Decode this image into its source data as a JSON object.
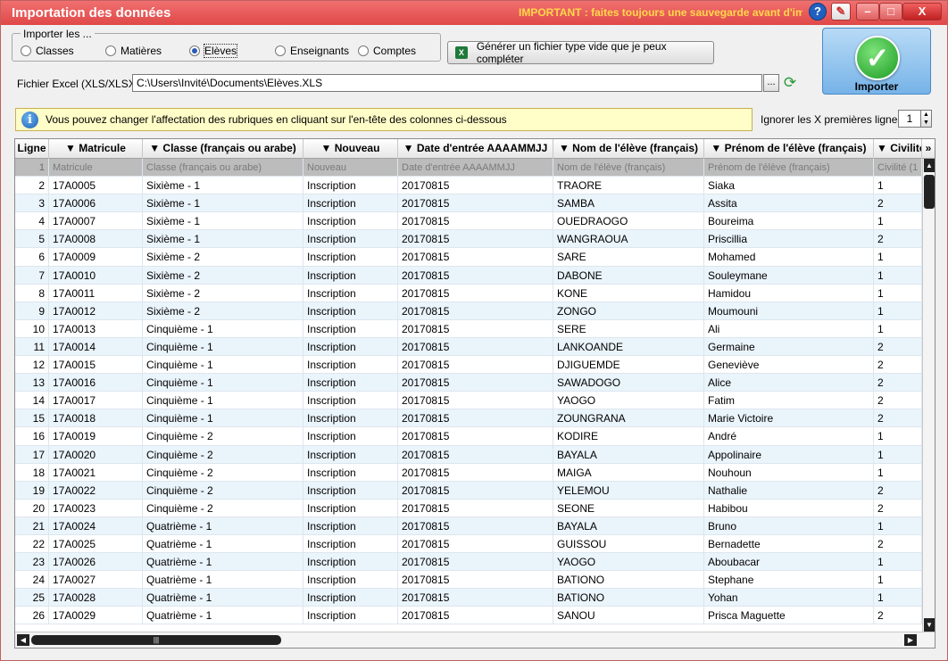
{
  "window": {
    "title": "Importation des données",
    "notice": "IMPORTANT : faites toujours une sauvegarde avant d'importer"
  },
  "import_group": {
    "legend": "Importer les ...",
    "options": [
      {
        "label": "Classes",
        "selected": false
      },
      {
        "label": "Matières",
        "selected": false
      },
      {
        "label": "Elèves",
        "selected": true
      },
      {
        "label": "Enseignants",
        "selected": false
      },
      {
        "label": "Comptes",
        "selected": false
      }
    ]
  },
  "generate_button": "Générer un fichier type vide que je peux compléter",
  "import_button": "Importer",
  "file": {
    "label": "Fichier Excel (XLS/XLSX)",
    "value": "C:\\Users\\Invité\\Documents\\Elèves.XLS",
    "browse": "..."
  },
  "info": "Vous pouvez changer l'affectation des rubriques en cliquant sur l'en-tête des colonnes ci-dessous",
  "ignore": {
    "label": "Ignorer les X premières lignes",
    "value": "1"
  },
  "grid": {
    "headers": [
      "Ligne",
      "▼ Matricule",
      "▼ Classe (français ou arabe)",
      "▼ Nouveau",
      "▼ Date d'entrée AAAAMMJJ",
      "▼ Nom de l'élève (français)",
      "▼ Prénom de l'élève (français)",
      "▼ Civilité"
    ],
    "first_row": [
      "1",
      "Matricule",
      "Classe (français ou arabe)",
      "Nouveau",
      "Date d'entrée AAAAMMJJ",
      "Nom de l'élève (français)",
      "Prénom de l'élève (français)",
      "Civilité (1"
    ],
    "rows": [
      [
        "2",
        "17A0005",
        "Sixième - 1",
        "Inscription",
        "20170815",
        "TRAORE",
        "Siaka",
        "1"
      ],
      [
        "3",
        "17A0006",
        "Sixième - 1",
        "Inscription",
        "20170815",
        "SAMBA",
        "Assita",
        "2"
      ],
      [
        "4",
        "17A0007",
        "Sixième - 1",
        "Inscription",
        "20170815",
        "OUEDRAOGO",
        "Boureima",
        "1"
      ],
      [
        "5",
        "17A0008",
        "Sixième - 1",
        "Inscription",
        "20170815",
        "WANGRAOUA",
        "Priscillia",
        "2"
      ],
      [
        "6",
        "17A0009",
        "Sixième - 2",
        "Inscription",
        "20170815",
        "SARE",
        "Mohamed",
        "1"
      ],
      [
        "7",
        "17A0010",
        "Sixième - 2",
        "Inscription",
        "20170815",
        "DABONE",
        "Souleymane",
        "1"
      ],
      [
        "8",
        "17A0011",
        "Sixième - 2",
        "Inscription",
        "20170815",
        "KONE",
        "Hamidou",
        "1"
      ],
      [
        "9",
        "17A0012",
        "Sixième - 2",
        "Inscription",
        "20170815",
        "ZONGO",
        "Moumouni",
        "1"
      ],
      [
        "10",
        "17A0013",
        "Cinquième - 1",
        "Inscription",
        "20170815",
        "SERE",
        "Ali",
        "1"
      ],
      [
        "11",
        "17A0014",
        "Cinquième - 1",
        "Inscription",
        "20170815",
        "LANKOANDE",
        "Germaine",
        "2"
      ],
      [
        "12",
        "17A0015",
        "Cinquième - 1",
        "Inscription",
        "20170815",
        "DJIGUEMDE",
        "Geneviève",
        "2"
      ],
      [
        "13",
        "17A0016",
        "Cinquième - 1",
        "Inscription",
        "20170815",
        "SAWADOGO",
        "Alice",
        "2"
      ],
      [
        "14",
        "17A0017",
        "Cinquième - 1",
        "Inscription",
        "20170815",
        "YAOGO",
        "Fatim",
        "2"
      ],
      [
        "15",
        "17A0018",
        "Cinquième - 1",
        "Inscription",
        "20170815",
        "ZOUNGRANA",
        "Marie Victoire",
        "2"
      ],
      [
        "16",
        "17A0019",
        "Cinquième - 2",
        "Inscription",
        "20170815",
        "KODIRE",
        "André",
        "1"
      ],
      [
        "17",
        "17A0020",
        "Cinquième - 2",
        "Inscription",
        "20170815",
        "BAYALA",
        "Appolinaire",
        "1"
      ],
      [
        "18",
        "17A0021",
        "Cinquième - 2",
        "Inscription",
        "20170815",
        "MAIGA",
        "Nouhoun",
        "1"
      ],
      [
        "19",
        "17A0022",
        "Cinquième - 2",
        "Inscription",
        "20170815",
        "YELEMOU",
        "Nathalie",
        "2"
      ],
      [
        "20",
        "17A0023",
        "Cinquième - 2",
        "Inscription",
        "20170815",
        "SEONE",
        "Habibou",
        "2"
      ],
      [
        "21",
        "17A0024",
        "Quatrième - 1",
        "Inscription",
        "20170815",
        "BAYALA",
        "Bruno",
        "1"
      ],
      [
        "22",
        "17A0025",
        "Quatrième - 1",
        "Inscription",
        "20170815",
        "GUISSOU",
        "Bernadette",
        "2"
      ],
      [
        "23",
        "17A0026",
        "Quatrième - 1",
        "Inscription",
        "20170815",
        "YAOGO",
        "Aboubacar",
        "1"
      ],
      [
        "24",
        "17A0027",
        "Quatrième - 1",
        "Inscription",
        "20170815",
        "BATIONO",
        "Stephane",
        "1"
      ],
      [
        "25",
        "17A0028",
        "Quatrième - 1",
        "Inscription",
        "20170815",
        "BATIONO",
        "Yohan",
        "1"
      ],
      [
        "26",
        "17A0029",
        "Quatrième - 1",
        "Inscription",
        "20170815",
        "SANOU",
        "Prisca Maguette",
        "2"
      ]
    ]
  },
  "colors": {
    "title_bar": "#e04848",
    "accent": "#2a5bb5",
    "import_button": "#76b3e8",
    "info_bar": "#fffdc8"
  },
  "icons": [
    "help-icon",
    "brush-icon",
    "minimize-icon",
    "maximize-icon",
    "close-icon",
    "excel-icon",
    "check-icon",
    "refresh-icon",
    "info-icon",
    "more-columns-icon"
  ]
}
